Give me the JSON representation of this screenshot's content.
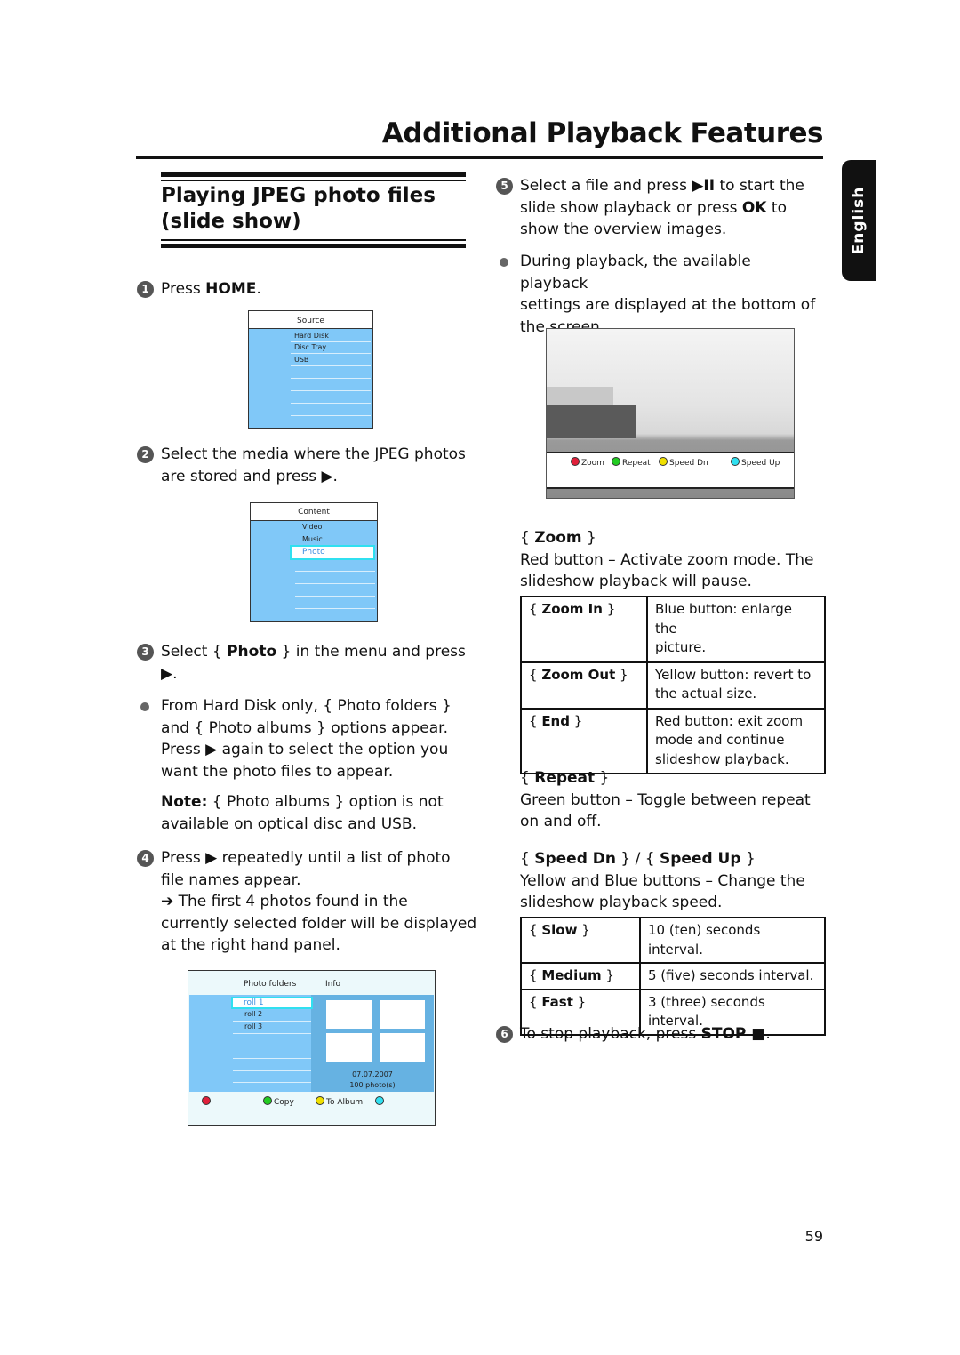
{
  "header": {
    "page_title": "Additional Playback Features",
    "language_tab": "English",
    "page_number": "59"
  },
  "section": {
    "title_line1": "Playing JPEG photo files",
    "title_line2": "(slide show)"
  },
  "steps": {
    "s1": {
      "num": "1",
      "pre": "Press ",
      "bold": "HOME",
      "post": "."
    },
    "s2": {
      "num": "2",
      "line1": "Select the media where the JPEG photos",
      "line2": "are stored and press ▶."
    },
    "s3": {
      "num": "3",
      "pre": "Select { ",
      "bold": "Photo",
      "post": " } in the menu and press",
      "line2": "▶."
    },
    "s3_bullet": {
      "lines": [
        "From Hard Disk only, { Photo folders }",
        "and { Photo albums } options appear.",
        "Press ▶ again to select the option you",
        "want the photo files to appear."
      ]
    },
    "s3_note": {
      "label": "Note:",
      "line1": " { Photo albums } option is not",
      "line2": "available on optical disc and USB."
    },
    "s4": {
      "num": "4",
      "lines": [
        "Press ▶ repeatedly until a list of photo",
        "file names appear.",
        "➔ The first 4 photos found in the",
        "currently selected folder will be displayed",
        "at the right hand panel."
      ]
    },
    "s5": {
      "num": "5",
      "pre": "Select a file and press ",
      "bold1": "▶II",
      "mid": " to start the",
      "line2_pre": "slide show playback or press ",
      "bold2": "OK",
      "line2_post": " to",
      "line3": "show the overview images."
    },
    "s5_bullet": {
      "lines": [
        "During playback, the available playback",
        "settings are displayed at the bottom of",
        "the screen."
      ]
    },
    "s6": {
      "num": "6",
      "pre": "To stop playback, press ",
      "bold": "STOP ■",
      "post": "."
    }
  },
  "source_menu": {
    "header": "Source",
    "items": [
      "Hard Disk",
      "Disc Tray",
      "USB"
    ]
  },
  "content_menu": {
    "header": "Content",
    "items": [
      "Video",
      "Music"
    ],
    "selected": "Photo"
  },
  "photo_browser": {
    "col1_header": "Photo folders",
    "col2_header": "Info",
    "selected": "roll 1",
    "items": [
      "roll 2",
      "roll 3"
    ],
    "date": "07.07.2007",
    "count": "100 photo(s)",
    "buttons": [
      {
        "color": "#e0203a",
        "label": ""
      },
      {
        "color": "#22cc22",
        "label": "Copy"
      },
      {
        "color": "#f0e000",
        "label": "To Album"
      },
      {
        "color": "#30e0f0",
        "label": ""
      }
    ]
  },
  "slideshow_screen": {
    "buttons": [
      {
        "color": "#e0203a",
        "label": "Zoom"
      },
      {
        "color": "#22cc22",
        "label": "Repeat"
      },
      {
        "color": "#f0e000",
        "label": "Speed Dn"
      },
      {
        "color": "#30e0f0",
        "label": "Speed Up"
      }
    ]
  },
  "zoom_section": {
    "heading": "Zoom",
    "line1": "Red button – Activate zoom mode.  The",
    "line2": "slideshow playback will pause.",
    "table": [
      {
        "option": "Zoom In",
        "desc1": "Blue button: enlarge the",
        "desc2": "picture.",
        "desc3": ""
      },
      {
        "option": "Zoom Out",
        "desc1": "Yellow button: revert to",
        "desc2": "the actual size.",
        "desc3": ""
      },
      {
        "option": "End",
        "desc1": "Red button: exit zoom",
        "desc2": "mode and continue",
        "desc3": "slideshow playback."
      }
    ]
  },
  "repeat_section": {
    "heading": "Repeat",
    "line1": "Green button – Toggle between repeat",
    "line2": "on and off."
  },
  "speed_section": {
    "heading1": "Speed Dn",
    "sep": " } / { ",
    "heading2": "Speed Up",
    "line1": "Yellow and Blue buttons – Change the",
    "line2": "slideshow playback speed.",
    "table": [
      {
        "option": "Slow",
        "desc": "10 (ten) seconds interval."
      },
      {
        "option": "Medium",
        "desc": "5 (five) seconds interval."
      },
      {
        "option": "Fast",
        "desc": "3 (three) seconds interval."
      }
    ]
  }
}
